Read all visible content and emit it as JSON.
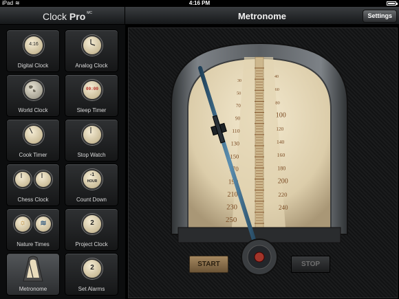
{
  "status_bar": {
    "device": "iPad",
    "time": "4:16 PM"
  },
  "app_title": {
    "name": "Clock",
    "suffix": "Pro",
    "mark": "MC"
  },
  "page_title": "Metronome",
  "settings_label": "Settings",
  "sidebar": {
    "items": [
      {
        "label": "Digital Clock",
        "icon": "digital-clock-icon",
        "face": "4:16"
      },
      {
        "label": "Analog Clock",
        "icon": "analog-clock-icon"
      },
      {
        "label": "World Clock",
        "icon": "globe-icon"
      },
      {
        "label": "Sleep Timer",
        "icon": "sleep-timer-icon",
        "face": "00:00"
      },
      {
        "label": "Cook Timer",
        "icon": "cook-timer-icon"
      },
      {
        "label": "Stop Watch",
        "icon": "stopwatch-icon"
      },
      {
        "label": "Chess Clock",
        "icon": "chess-clock-icon"
      },
      {
        "label": "Count Down",
        "icon": "countdown-icon",
        "face_top": "-1",
        "face_bottom": "HOUR"
      },
      {
        "label": "Nature Times",
        "icon": "nature-times-icon"
      },
      {
        "label": "Project Clock",
        "icon": "project-clock-icon",
        "face": "2"
      },
      {
        "label": "Metronome",
        "icon": "metronome-icon"
      },
      {
        "label": "Set Alarms",
        "icon": "alarm-icon",
        "face": "2"
      }
    ],
    "selected": "Metronome"
  },
  "metronome": {
    "scale_left": [
      "30",
      "50",
      "70",
      "90",
      "110",
      "130",
      "150",
      "170",
      "190",
      "210",
      "230",
      "250"
    ],
    "scale_right": [
      "40",
      "60",
      "80",
      "100",
      "120",
      "140",
      "160",
      "180",
      "200",
      "220",
      "240"
    ],
    "start_label": "START",
    "stop_label": "STOP",
    "colors": {
      "face": "#e9dcbc",
      "ink": "#7a4a22",
      "frame": "#5b5f63",
      "pendulum": "#3c6f8f"
    }
  }
}
